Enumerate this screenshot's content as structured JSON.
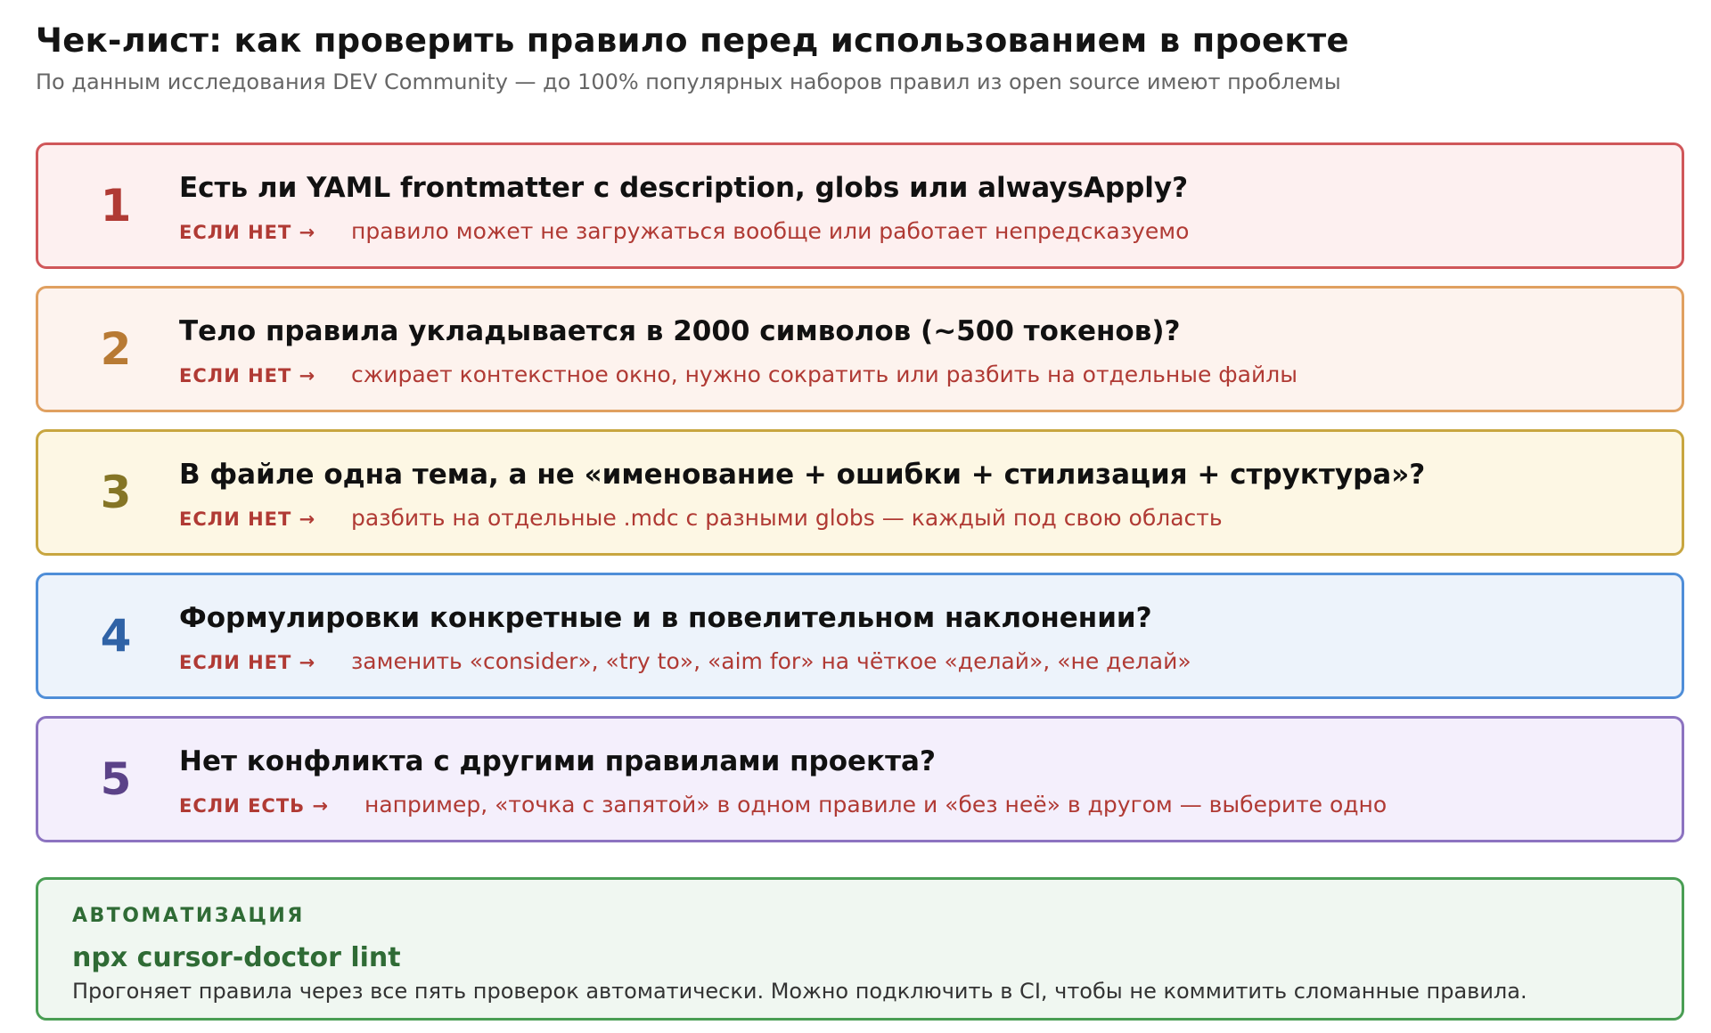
{
  "header": {
    "title": "Чек-лист: как проверить правило перед использованием в проекте",
    "subtitle": "По данным исследования DEV Community — до 100% популярных наборов правил из open source имеют проблемы"
  },
  "checklist": [
    {
      "number": "1",
      "question": "Есть ли YAML frontmatter с description, globs или alwaysApply?",
      "if_label": "ЕСЛИ НЕТ →",
      "consequence": "правило может не загружаться вообще или работает непредсказуемо",
      "colors": {
        "border": "#d0575a",
        "background": "#fdf0f0",
        "number": "#b03a34"
      }
    },
    {
      "number": "2",
      "question": "Тело правила укладывается в 2000 символов (~500 токенов)?",
      "if_label": "ЕСЛИ НЕТ →",
      "consequence": "сжирает контекстное окно, нужно сократить или разбить на отдельные файлы",
      "colors": {
        "border": "#e0a060",
        "background": "#fdf3ee",
        "number": "#b87a34"
      }
    },
    {
      "number": "3",
      "question": "В файле одна тема, а не «именование + ошибки + стилизация + структура»?",
      "if_label": "ЕСЛИ НЕТ →",
      "consequence": "разбить на отдельные .mdc с разными globs — каждый под свою область",
      "colors": {
        "border": "#c8a640",
        "background": "#fdf7e4",
        "number": "#857525"
      }
    },
    {
      "number": "4",
      "question": "Формулировки конкретные и в повелительном наклонении?",
      "if_label": "ЕСЛИ НЕТ →",
      "consequence": "заменить «consider», «try to», «aim for» на чёткое «делай», «не делай»",
      "colors": {
        "border": "#4f8ed8",
        "background": "#edf3fb",
        "number": "#2f62a6"
      }
    },
    {
      "number": "5",
      "question": "Нет конфликта с другими правилами проекта?",
      "if_label": "ЕСЛИ ЕСТЬ →",
      "consequence": "например, «точка с запятой» в одном правиле и «без неё» в другом — выберите одно",
      "colors": {
        "border": "#8c73c0",
        "background": "#f4effc",
        "number": "#5b4288"
      }
    }
  ],
  "automation": {
    "label": "АВТОМАТИЗАЦИЯ",
    "command": "npx cursor-doctor lint",
    "description": "Прогоняет правила через все пять проверок автоматически. Можно подключить в CI, чтобы не коммитить сломанные правила."
  }
}
